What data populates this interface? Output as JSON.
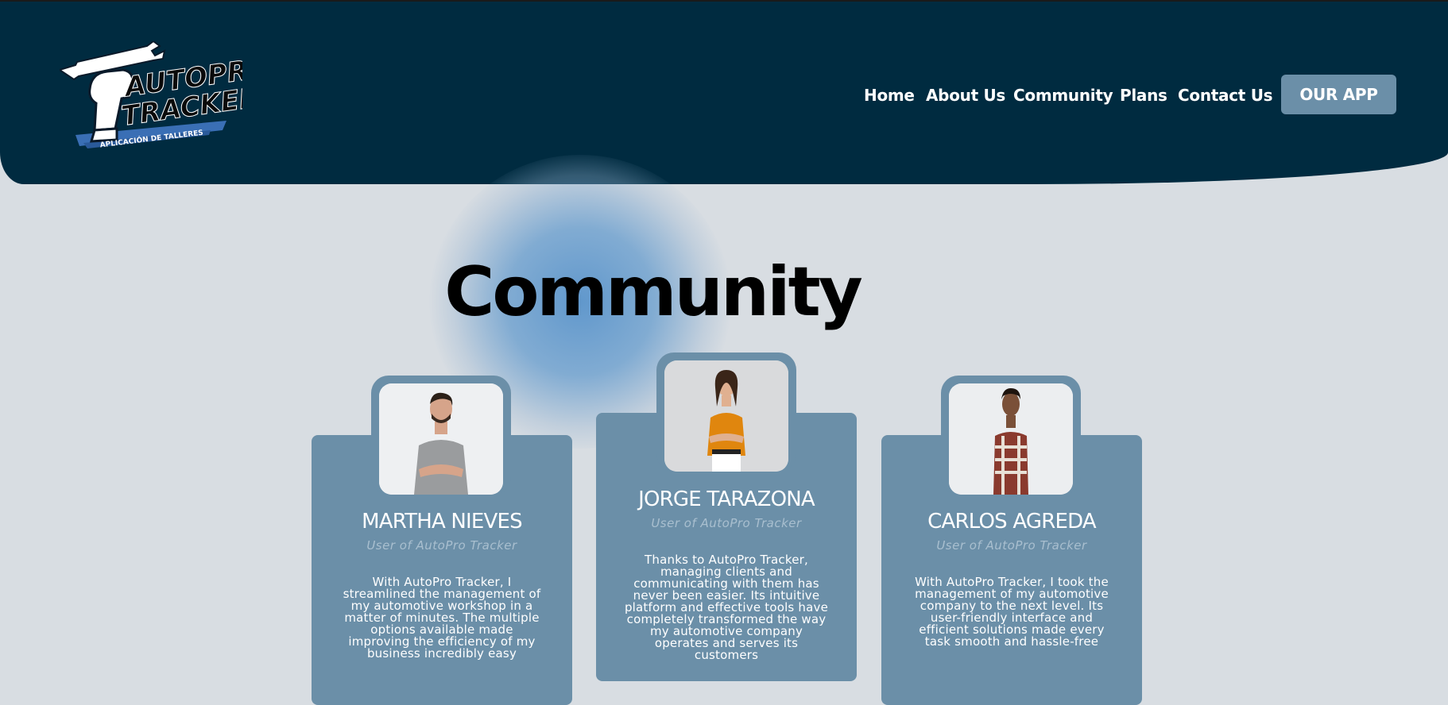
{
  "brand": {
    "logo_line1": "AUTOPRO",
    "logo_line2": "TRACKER",
    "logo_tagline": "APLICACIÓN DE TALLERES"
  },
  "nav": {
    "items": [
      {
        "label": "Home"
      },
      {
        "label": "About Us"
      },
      {
        "label": "Community"
      },
      {
        "label": "Plans"
      },
      {
        "label": "Contact Us"
      }
    ],
    "cta_label": "OUR APP"
  },
  "section": {
    "title": "Community"
  },
  "testimonials": [
    {
      "name": "MARTHA NIEVES",
      "role": "User of AutoPro Tracker",
      "quote": "With AutoPro Tracker, I streamlined the management of my automotive workshop in a matter of minutes. The multiple options available made improving the efficiency of my business incredibly easy"
    },
    {
      "name": "JORGE TARAZONA",
      "role": "User of AutoPro Tracker",
      "quote": "Thanks to AutoPro Tracker, managing clients and communicating with them has never been easier. Its intuitive platform and effective tools have completely transformed the way my automotive company operates and serves its customers"
    },
    {
      "name": "CARLOS AGREDA",
      "role": "User of AutoPro Tracker",
      "quote": "With AutoPro Tracker, I took the management of my automotive company to the next level. Its user-friendly interface and efficient solutions made every task smooth and hassle-free"
    }
  ],
  "colors": {
    "header_bg": "#002b40",
    "page_bg": "#d8dde2",
    "card_bg": "#6b8fa8",
    "accent_glow": "#5a94cb"
  }
}
